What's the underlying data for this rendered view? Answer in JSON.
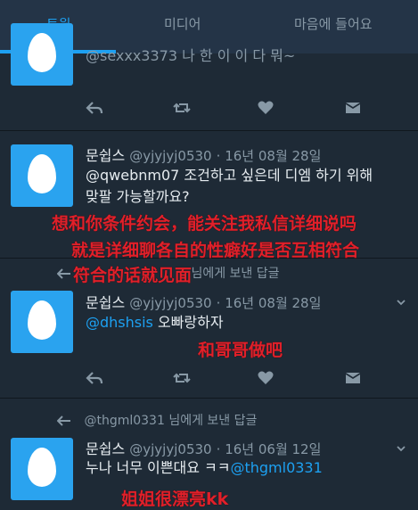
{
  "tabs": [
    "트윗",
    "미디어",
    "마음에 들어요"
  ],
  "tweet0": {
    "text": "@sexxx3373 나 한 이 이 다 뭐~"
  },
  "tweet1": {
    "name": "문쉽스",
    "handle": "@yjyjyj0530",
    "date": "· 16년 08월 28일",
    "text_line1": "@qwebnm07 조건하고 싶은데 디엠 하기 위해",
    "text_line2": "맞팔 가능할까요?"
  },
  "tweet2": {
    "reply_note": "님에게 보낸 답글",
    "name": "문쉽스",
    "handle": "@yjyjyj0530",
    "date": "· 16년 08월 28일",
    "mention": "@dhshsis",
    "text": "오빠랑하자"
  },
  "tweet3": {
    "reply_handle": "@thgml0331",
    "reply_note": "님에게 보낸 답글",
    "name": "문쉽스",
    "handle": "@yjyjyj0530",
    "date": "· 16년 06월 12일",
    "text": "누나 너무 이쁜대요 ㅋㅋ",
    "mention": "@thgml0331"
  },
  "annotations": {
    "line1": "想和你条件约会，能关注我私信详细说吗",
    "line2": "就是详细聊各自的性癖好是否互相符合",
    "line3": "符合的话就见面",
    "line4": "和哥哥做吧",
    "line5": "姐姐很漂亮kk"
  },
  "colors": {
    "accent": "#1da1f2",
    "background": "#1e2a36",
    "overlay": "#e0202a"
  }
}
